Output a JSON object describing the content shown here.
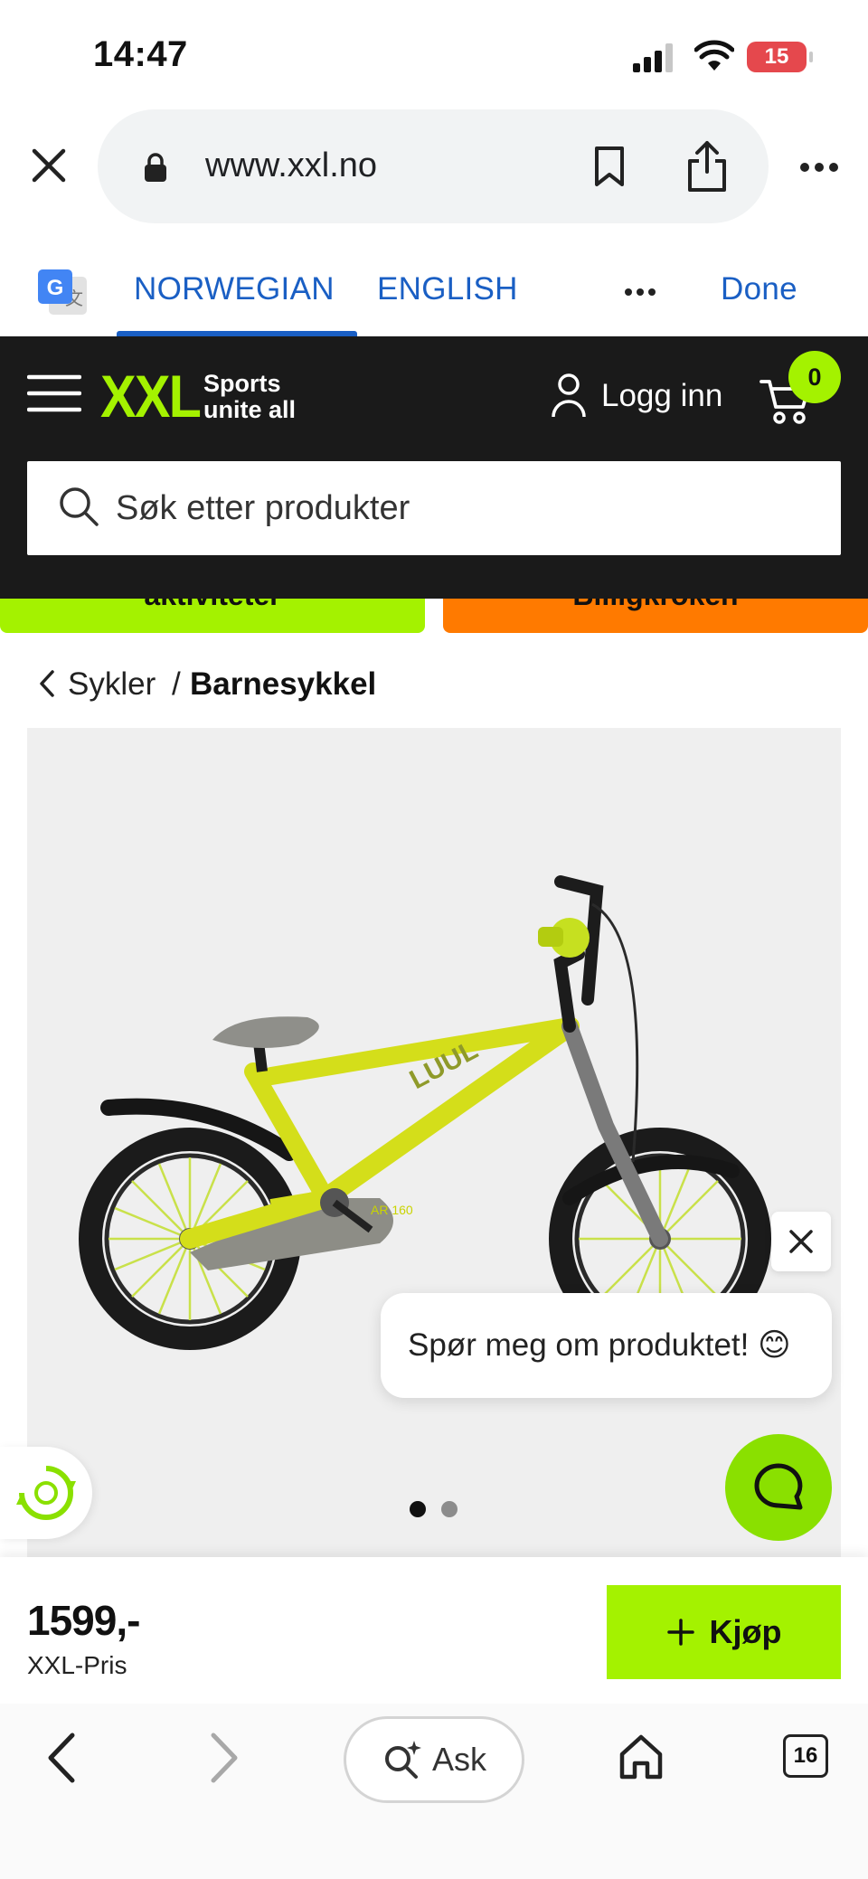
{
  "status_bar": {
    "time": "14:47",
    "battery": "15"
  },
  "browser": {
    "url": "www.xxl.no"
  },
  "translate_bar": {
    "tabs": [
      "NORWEGIAN",
      "ENGLISH"
    ],
    "done_label": "Done"
  },
  "site_header": {
    "logo": "XXL",
    "tagline_line1": "Sports",
    "tagline_line2": "unite all",
    "login_label": "Logg inn",
    "cart_count": "0",
    "search_placeholder": "Søk etter produkter"
  },
  "promos": [
    {
      "label": "aktiviteter",
      "color": "#a4f200"
    },
    {
      "label": "Billigkroken",
      "color": "#ff7a00"
    }
  ],
  "breadcrumb": {
    "parent": "Sykler",
    "separator": "/",
    "current": "Barnesykkel"
  },
  "product_image": {
    "frame_text": "AR 160",
    "slide_count": 2,
    "active_slide": 1
  },
  "chat": {
    "prompt": "Spør meg om produktet! 😊"
  },
  "buy_bar": {
    "price": "1599,-",
    "price_label": "XXL-Pris",
    "buy_label": "Kjøp"
  },
  "bottom_bar": {
    "ask_label": "Ask",
    "tab_count": "16"
  },
  "colors": {
    "brand_green": "#a4f200",
    "link_blue": "#1a5fc4",
    "header_dark": "#1a1a1a"
  }
}
